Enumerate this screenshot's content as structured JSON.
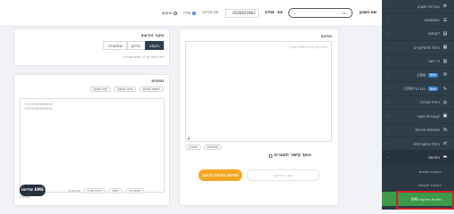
{
  "topbar": {
    "account_label": "שם חשבון",
    "account_value": "...דו",
    "sender_label": "מס׳ שולח",
    "sender_value": "0526021963",
    "schedule_label": "זמן שליחה",
    "now_label": "מיידי",
    "scheduled_label": "מתוזמן"
  },
  "sender": {
    "title": "מקור הודעות",
    "opt_text": "טקסט",
    "opt_phone": "טלפון",
    "opt_name": "שם/שולח",
    "help": "ניתן לבחור עד 11 תווים באנגלית"
  },
  "message": {
    "title": "הודעה",
    "placeholder": "כתוב כאן את ה-SMS שלך...",
    "chars_pill": "0 תווים",
    "sms_pill": "0 הודעות",
    "link_label": "הוסף קישור לתוצרים",
    "send_test": "שליחת הודעת בדיקה",
    "test_phone_placeholder": "מס׳ הבדיקה"
  },
  "recipients": {
    "title": "נמענים",
    "tab1": "רשימת נמענים",
    "tab2": "ניהול קבוצות",
    "tab3": "ייבוא מקובץ",
    "numbers": [
      "+972500000000",
      "+972500000001"
    ],
    "count_text": "0 נמענים",
    "send_sms": "שליחת SMS",
    "opt1": "אפשרויות",
    "opt2": "תזמון",
    "opt3": "ביטול הסרה",
    "opt4": "0 הודעות"
  },
  "sidebar": {
    "items": [
      {
        "label": "הגדרות חשבון",
        "icon": "gear-icon",
        "glyph": "⚙",
        "chev": "‹"
      },
      {
        "label": "המשתמש",
        "icon": "user-icon",
        "glyph": "☰",
        "chev": "‹"
      },
      {
        "label": "לקוחות",
        "icon": "contacts-icon",
        "glyph": "▤",
        "chev": "‹"
      },
      {
        "label": "ניהול מלאי/פריט",
        "icon": "box-icon",
        "glyph": "▦",
        "chev": "‹"
      },
      {
        "label": "דו״חות",
        "icon": "report-icon",
        "glyph": "▥",
        "chev": "‹"
      },
      {
        "label": "CRM",
        "icon": "crm-icon",
        "glyph": "✉",
        "chev": "‹",
        "badge": "New"
      },
      {
        "label": "הגדרות CRM",
        "icon": "crm-settings-icon",
        "glyph": "✎",
        "chev": "‹",
        "badge": "New"
      },
      {
        "label": "ניהול מטרות",
        "icon": "target-icon",
        "glyph": "◎",
        "chev": "‹"
      },
      {
        "label": "קטגוריות מוצר",
        "icon": "category-icon",
        "glyph": "▣",
        "chev": "‹"
      },
      {
        "label": "מבצעים והנחות",
        "icon": "discount-icon",
        "glyph": "％",
        "chev": "‹"
      },
      {
        "label": "ניהול אינטגרציות",
        "icon": "integration-icon",
        "glyph": "⇄",
        "chev": "‹"
      }
    ],
    "messages_label": "הודעות",
    "messages_icon": "chat-icon",
    "sub_items": [
      {
        "label": "הודעות למנויים"
      },
      {
        "label": "הודעות לקבוצה"
      },
      {
        "label": "שליחת הודעות SMS",
        "active": true
      },
      {
        "label": "דו״ח יומן הודעות SMS",
        "boxed": true
      }
    ]
  }
}
